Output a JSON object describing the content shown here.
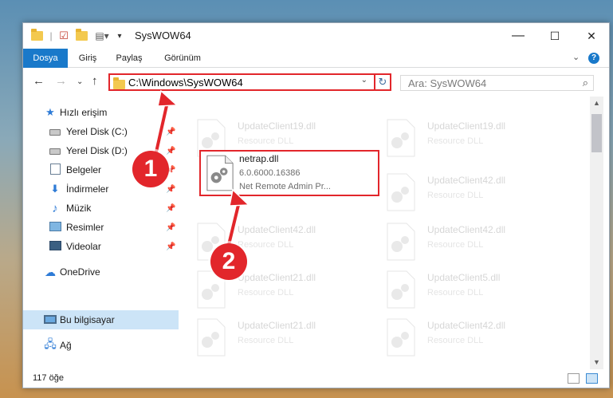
{
  "window": {
    "title": "SysWOW64",
    "controls": {
      "minimize": "—",
      "maximize": "☐",
      "close": "✕"
    }
  },
  "ribbon": {
    "tabs": [
      {
        "label": "Dosya"
      },
      {
        "label": "Giriş"
      },
      {
        "label": "Paylaş"
      },
      {
        "label": "Görünüm"
      }
    ],
    "collapse": "⌄",
    "help": "?"
  },
  "address": {
    "path": "C:\\Windows\\SysWOW64",
    "dropdown": "⌄",
    "refresh": "↻"
  },
  "search": {
    "placeholder": "Ara: SysWOW64",
    "icon": "search-icon"
  },
  "nav": {
    "back": "←",
    "forward": "→",
    "recent": "⌄",
    "up": "↑"
  },
  "sidebar": {
    "items": [
      {
        "label": "Hızlı erişim",
        "icon": "star-icon"
      },
      {
        "label": "Yerel Disk (C:)",
        "icon": "drive-icon"
      },
      {
        "label": "Yerel Disk (D:)",
        "icon": "drive-icon"
      },
      {
        "label": "Belgeler",
        "icon": "documents-icon"
      },
      {
        "label": "İndirmeler",
        "icon": "download-icon"
      },
      {
        "label": "Müzik",
        "icon": "music-icon"
      },
      {
        "label": "Resimler",
        "icon": "pictures-icon"
      },
      {
        "label": "Videolar",
        "icon": "videos-icon"
      },
      {
        "label": "OneDrive",
        "icon": "cloud-icon"
      },
      {
        "label": "Bu bilgisayar",
        "icon": "computer-icon"
      },
      {
        "label": "Ağ",
        "icon": "network-icon"
      }
    ]
  },
  "files": [
    {
      "name": "UpdateClient19.dll",
      "type": "Resource DLL"
    },
    {
      "name": "UpdateClient19.dll",
      "type": "Resource DLL"
    },
    {
      "name": "netrap.dll",
      "version": "6.0.6000.16386",
      "desc": "Net Remote Admin Pr..."
    },
    {
      "name": "UpdateClient42.dll",
      "type": "Resource DLL"
    },
    {
      "name": "UpdateClient42.dll",
      "type": "Resource DLL"
    },
    {
      "name": "UpdateClient42.dll",
      "type": "Resource DLL"
    },
    {
      "name": "UpdateClient21.dll",
      "type": "Resource DLL"
    },
    {
      "name": "UpdateClient5.dll",
      "type": "Resource DLL"
    },
    {
      "name": "UpdateClient21.dll",
      "type": "Resource DLL"
    },
    {
      "name": "UpdateClient42.dll",
      "type": "Resource DLL"
    }
  ],
  "status": {
    "count": "117 öğe"
  },
  "callouts": {
    "one": "1",
    "two": "2"
  },
  "colors": {
    "accent": "#1979ca",
    "highlight": "#e2262b",
    "selected": "#cce4f7"
  }
}
